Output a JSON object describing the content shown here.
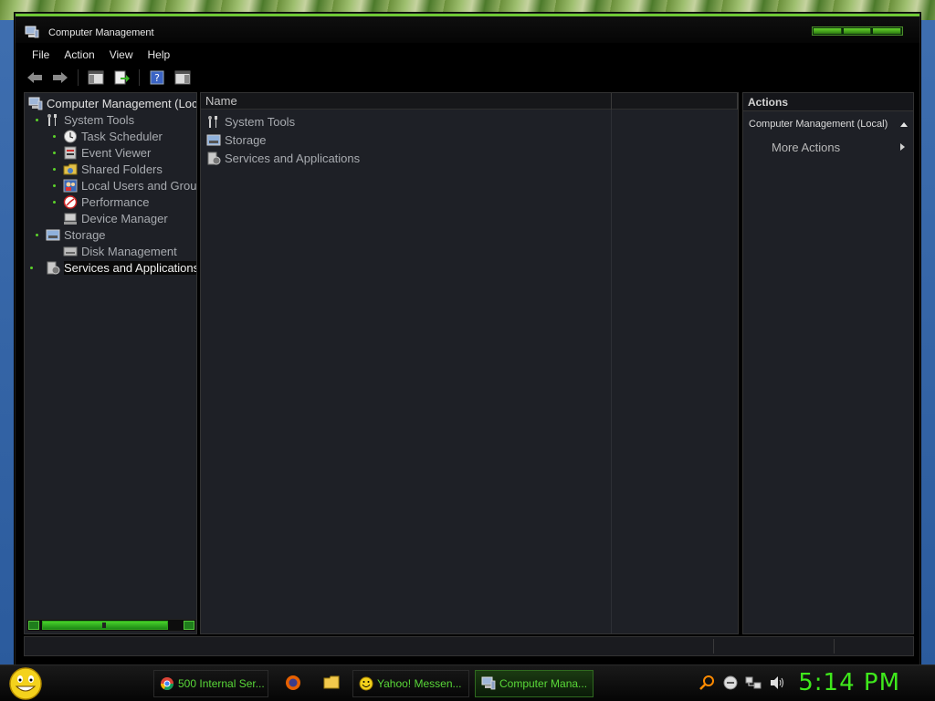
{
  "window": {
    "title": "Computer Management"
  },
  "menubar": {
    "items": [
      "File",
      "Action",
      "View",
      "Help"
    ]
  },
  "toolbar": {
    "buttons": [
      "back-icon",
      "forward-icon",
      "show-hide-console-tree-icon",
      "export-list-icon",
      "help-icon",
      "show-hide-action-pane-icon"
    ]
  },
  "tree": {
    "root": "Computer Management (Loc",
    "items": [
      {
        "label": "System Tools",
        "level": 1,
        "icon": "tools-icon"
      },
      {
        "label": "Task Scheduler",
        "level": 2,
        "icon": "clock-icon"
      },
      {
        "label": "Event Viewer",
        "level": 2,
        "icon": "event-viewer-icon"
      },
      {
        "label": "Shared Folders",
        "level": 2,
        "icon": "shared-folder-icon"
      },
      {
        "label": "Local Users and Grou",
        "level": 2,
        "icon": "users-icon"
      },
      {
        "label": "Performance",
        "level": 2,
        "icon": "performance-icon"
      },
      {
        "label": "Device Manager",
        "level": 2,
        "icon": "device-manager-icon"
      },
      {
        "label": "Storage",
        "level": 1,
        "icon": "storage-icon"
      },
      {
        "label": "Disk Management",
        "level": 2,
        "icon": "disk-icon"
      },
      {
        "label": "Services and Applications",
        "level": 1,
        "icon": "services-icon"
      }
    ]
  },
  "list": {
    "column_name": "Name",
    "rows": [
      "System Tools",
      "Storage",
      "Services and Applications"
    ]
  },
  "actions": {
    "header": "Actions",
    "section": "Computer Management (Local)",
    "more": "More Actions"
  },
  "taskbar": {
    "buttons": [
      {
        "label": "500 Internal Ser...",
        "icon": "chrome-icon"
      },
      {
        "label": "Yahoo! Messen...",
        "icon": "yahoo-messenger-icon"
      },
      {
        "label": "Computer Mana...",
        "icon": "computer-management-icon"
      }
    ],
    "clock": "5:14 PM"
  },
  "colors": {
    "accent": "#5cd12a",
    "clock": "#3fe81c",
    "pane_bg": "#1e2026"
  }
}
